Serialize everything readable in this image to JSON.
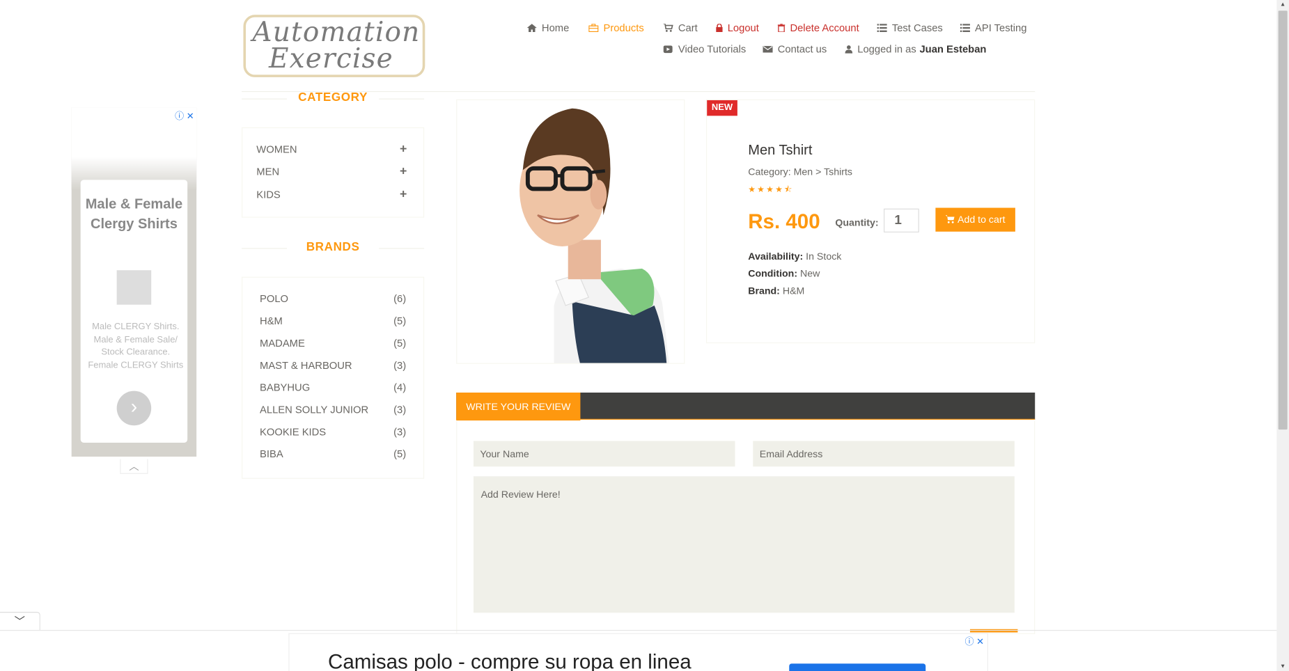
{
  "logo": {
    "line1": "Automation",
    "line2": "Exercise"
  },
  "nav": {
    "home": "Home",
    "products": "Products",
    "cart": "Cart",
    "logout": "Logout",
    "delete_account": "Delete Account",
    "test_cases": "Test Cases",
    "api_testing": "API Testing",
    "video_tutorials": "Video Tutorials",
    "contact_us": "Contact us",
    "logged_in_prefix": "Logged in as",
    "username": "Juan Esteban"
  },
  "left_ad": {
    "marks": "ⓘ ✕",
    "title": "Male & Female Clergy Shirts",
    "description": "Male CLERGY Shirts. Male & Female Sale/ Stock Clearance. Female CLERGY Shirts"
  },
  "sidebar": {
    "category_heading": "CATEGORY",
    "categories": [
      {
        "label": "WOMEN",
        "icon": "+"
      },
      {
        "label": "MEN",
        "icon": "+"
      },
      {
        "label": "KIDS",
        "icon": "+"
      }
    ],
    "brands_heading": "BRANDS",
    "brands": [
      {
        "name": "POLO",
        "count": "(6)"
      },
      {
        "name": "H&M",
        "count": "(5)"
      },
      {
        "name": "MADAME",
        "count": "(5)"
      },
      {
        "name": "MAST & HARBOUR",
        "count": "(3)"
      },
      {
        "name": "BABYHUG",
        "count": "(4)"
      },
      {
        "name": "ALLEN SOLLY JUNIOR",
        "count": "(3)"
      },
      {
        "name": "KOOKIE KIDS",
        "count": "(3)"
      },
      {
        "name": "BIBA",
        "count": "(5)"
      }
    ]
  },
  "product": {
    "badge": "NEW",
    "name": "Men Tshirt",
    "category": "Category: Men > Tshirts",
    "rating": 4.5,
    "stars": "★★★★⯪",
    "price": "Rs. 400",
    "quantity_label": "Quantity:",
    "quantity": "1",
    "add_to_cart": "Add to cart",
    "availability_label": "Availability:",
    "availability": "In Stock",
    "condition_label": "Condition:",
    "condition": "New",
    "brand_label": "Brand:",
    "brand": "H&M"
  },
  "review": {
    "tab": "WRITE YOUR REVIEW",
    "name_placeholder": "Your Name",
    "email_placeholder": "Email Address",
    "review_placeholder": "Add Review Here!"
  },
  "bottom_ad": {
    "headline": "Camisas polo - compre su ropa en linea",
    "marks": "ⓘ ✕"
  },
  "colors": {
    "accent": "#fe980f",
    "text": "#696763",
    "dark_bar": "#40403e",
    "badge_red": "#e02a2a"
  }
}
